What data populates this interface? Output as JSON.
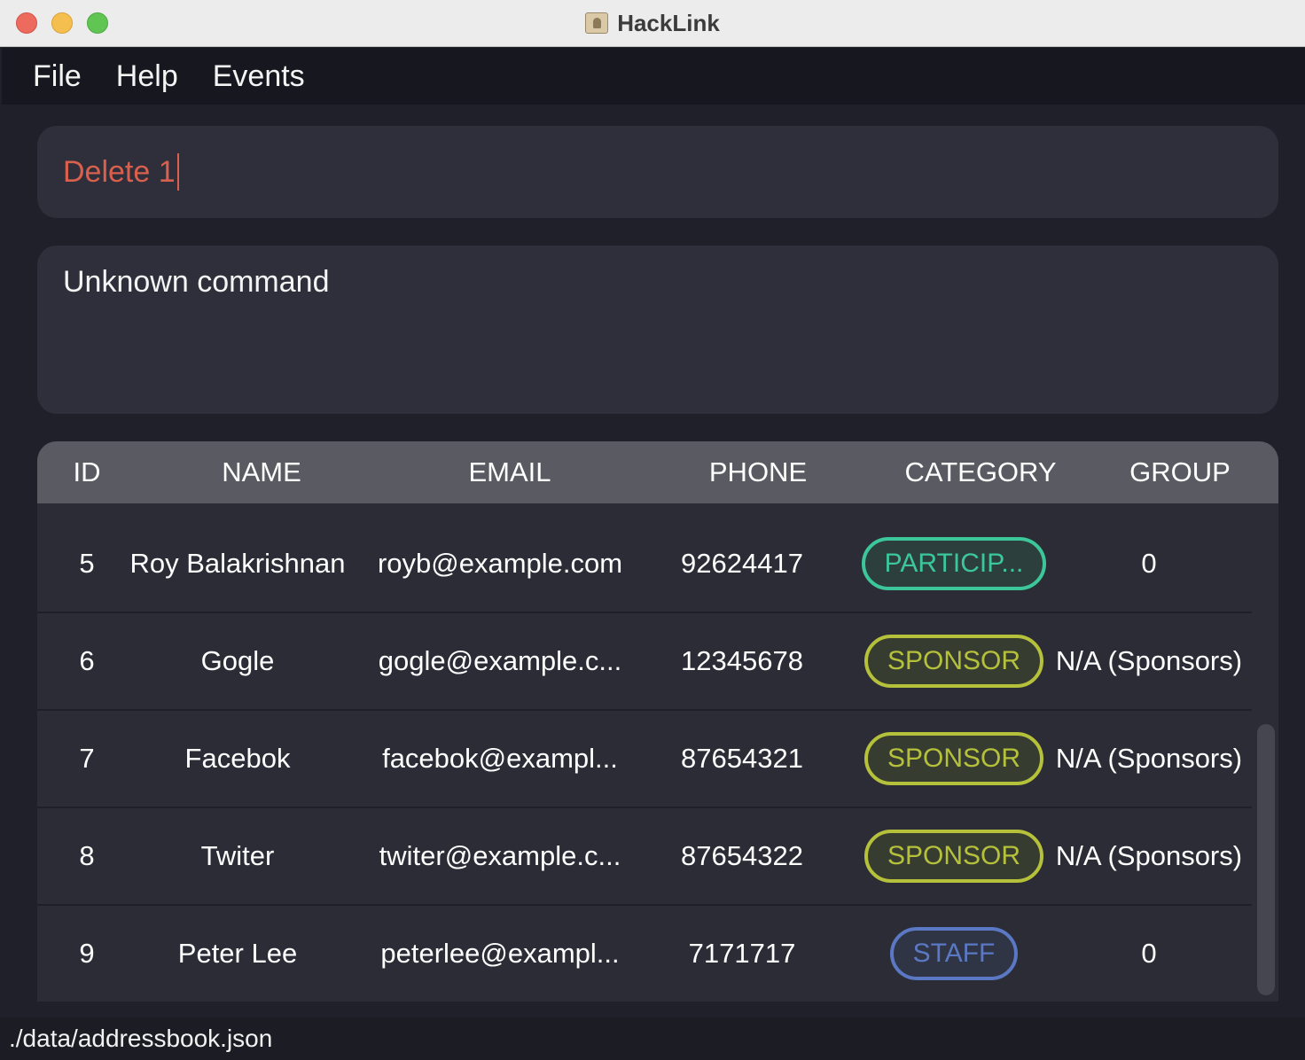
{
  "window": {
    "title": "HackLink"
  },
  "menu": {
    "items": [
      "File",
      "Help",
      "Events"
    ]
  },
  "command": {
    "value": "Delete 1"
  },
  "result": {
    "text": "Unknown command"
  },
  "table": {
    "columns": [
      "ID",
      "NAME",
      "EMAIL",
      "PHONE",
      "CATEGORY",
      "GROUP"
    ],
    "rows": [
      {
        "id": "5",
        "name": "Roy Balakrishnan",
        "email": "royb@example.com",
        "phone": "92624417",
        "category": "PARTICIP...",
        "category_type": "participant",
        "group": "0"
      },
      {
        "id": "6",
        "name": "Gogle",
        "email": "gogle@example.c...",
        "phone": "12345678",
        "category": "SPONSOR",
        "category_type": "sponsor",
        "group": "N/A (Sponsors)"
      },
      {
        "id": "7",
        "name": "Facebok",
        "email": "facebok@exampl...",
        "phone": "87654321",
        "category": "SPONSOR",
        "category_type": "sponsor",
        "group": "N/A (Sponsors)"
      },
      {
        "id": "8",
        "name": "Twiter",
        "email": "twiter@example.c...",
        "phone": "87654322",
        "category": "SPONSOR",
        "category_type": "sponsor",
        "group": "N/A (Sponsors)"
      },
      {
        "id": "9",
        "name": "Peter Lee",
        "email": "peterlee@exampl...",
        "phone": "7171717",
        "category": "STAFF",
        "category_type": "staff",
        "group": "0"
      }
    ]
  },
  "status": {
    "path": "./data/addressbook.json"
  },
  "colors": {
    "participant": "#3cc79b",
    "sponsor": "#b5c13a",
    "staff": "#5a78c3",
    "command_text": "#d9604d"
  }
}
